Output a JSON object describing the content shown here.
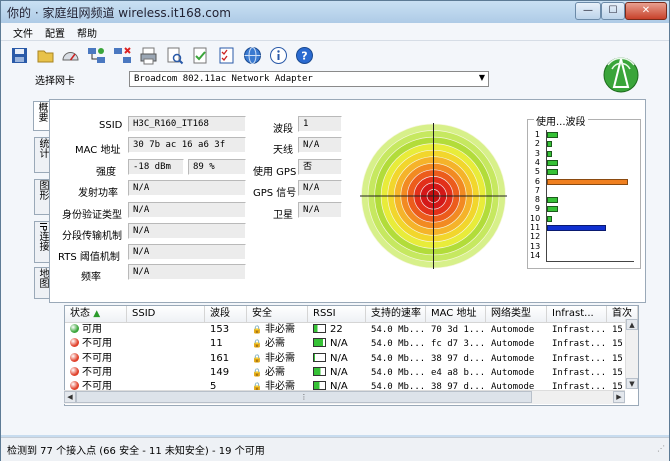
{
  "window": {
    "title": "你的 · 家庭组网频道 wireless.it168.com",
    "minimize": "—",
    "maximize": "☐",
    "close": "✕"
  },
  "menu": [
    "文件",
    "配置",
    "帮助"
  ],
  "toolbar": [
    "save-icon",
    "open-folder-icon",
    "gauge-icon",
    "network-connect-icon",
    "network-disconnect-icon",
    "print-icon",
    "print-preview-icon",
    "options-icon",
    "checklist-icon",
    "globe-icon",
    "info-icon",
    "help-icon"
  ],
  "adapter": {
    "label": "选择网卡",
    "value": "Broadcom 802.11ac Network Adapter"
  },
  "tabs": [
    "概要",
    "统计",
    "图形",
    "IP连接",
    "地图"
  ],
  "details": {
    "ssid_label": "SSID",
    "ssid": "H3C_R160_IT168",
    "mac_label": "MAC 地址",
    "mac": "30 7b ac 16 a6 3f",
    "strength_label": "强度",
    "strength_dbm": "-18 dBm",
    "strength_pct": "89 %",
    "txpower_label": "发射功率",
    "txpower": "N/A",
    "auth_label": "身份验证类型",
    "auth": "N/A",
    "frag_label": "分段传输机制",
    "frag": "N/A",
    "rts_label": "RTS 阈值机制",
    "rts": "N/A",
    "freq_label": "频率",
    "freq": "N/A",
    "channel_label": "波段",
    "channel": "1",
    "antenna_label": "天线",
    "antenna": "N/A",
    "gps_use_label": "使用 GPS",
    "gps_use": "否",
    "gps_signal_label": "GPS 信号",
    "gps_signal": "N/A",
    "satellite_label": "卫星",
    "satellite": "N/A"
  },
  "channel_usage": {
    "title": "使用...波段",
    "channels": [
      "1",
      "2",
      "3",
      "4",
      "5",
      "6",
      "7",
      "8",
      "9",
      "10",
      "11",
      "12",
      "13",
      "14"
    ],
    "usage": [
      2,
      1,
      1,
      2,
      2,
      15,
      0,
      2,
      2,
      1,
      11,
      0,
      0,
      0
    ],
    "bar_colors": [
      "#36c236",
      "#36c236",
      "#36c236",
      "#36c236",
      "#36c236",
      "#f08020",
      "#36c236",
      "#36c236",
      "#36c236",
      "#36c236",
      "#1030d0",
      "#36c236",
      "#36c236",
      "#36c236"
    ]
  },
  "table": {
    "columns": [
      "状态",
      "SSID",
      "波段",
      "安全",
      "RSSI",
      "支持的速率",
      "MAC 地址",
      "网络类型",
      "Infrast...",
      "首次"
    ],
    "rows": [
      {
        "status": "可用",
        "status_color": "#3aa53a",
        "ssid": "",
        "channel": "153",
        "security": "非必需",
        "rssi": "22",
        "rssi_fill": 0.3,
        "rate": "54.0 Mb...",
        "mac": "70 3d 1...",
        "type": "Automode",
        "infra": "Infrast...",
        "first": "15:"
      },
      {
        "status": "不可用",
        "status_color": "#e0402a",
        "ssid": "",
        "channel": "11",
        "security": "必需",
        "rssi": "N/A",
        "rssi_fill": 0.8,
        "rate": "54.0 Mb...",
        "mac": "fc d7 3...",
        "type": "Automode",
        "infra": "Infrast...",
        "first": "15:"
      },
      {
        "status": "不可用",
        "status_color": "#e0402a",
        "ssid": "",
        "channel": "161",
        "security": "非必需",
        "rssi": "N/A",
        "rssi_fill": 0.1,
        "rate": "54.0 Mb...",
        "mac": "38 97 d...",
        "type": "Automode",
        "infra": "Infrast...",
        "first": "15:"
      },
      {
        "status": "不可用",
        "status_color": "#e0402a",
        "ssid": "",
        "channel": "149",
        "security": "必需",
        "rssi": "N/A",
        "rssi_fill": 0.6,
        "rate": "54.0 Mb...",
        "mac": "e4 a8 b...",
        "type": "Automode",
        "infra": "Infrast...",
        "first": "15:"
      },
      {
        "status": "不可用",
        "status_color": "#e0402a",
        "ssid": "",
        "channel": "5",
        "security": "非必需",
        "rssi": "N/A",
        "rssi_fill": 0.5,
        "rate": "54.0 Mb...",
        "mac": "38 97 d...",
        "type": "Automode",
        "infra": "Infrast...",
        "first": "15:"
      }
    ]
  },
  "status_bar": "检测到 77 个接入点 (66 安全 - 11 未知安全) - 19 个可用",
  "colors": {
    "accent": "#1030d0",
    "available": "#3aa53a",
    "unavailable": "#e0402a"
  }
}
